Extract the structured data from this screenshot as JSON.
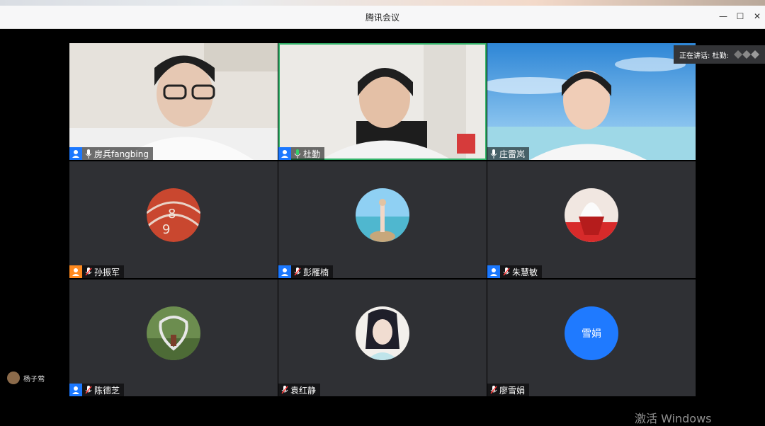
{
  "window": {
    "title": "腾讯会议"
  },
  "controls": {
    "minimize": "—",
    "maximize": "☐",
    "close": "✕"
  },
  "speaking": {
    "text": "正在讲话: 杜勤:"
  },
  "participants": [
    {
      "name": "房兵fangbing"
    },
    {
      "name": "杜勤"
    },
    {
      "name": "庄雷岚"
    },
    {
      "name": "孙振军"
    },
    {
      "name": "彭雁楠"
    },
    {
      "name": "朱慧敏"
    },
    {
      "name": "陈德芝"
    },
    {
      "name": "袁红静"
    },
    {
      "name": "廖雪娟",
      "avatar_text": "雪娟"
    }
  ],
  "sidebar_user": {
    "name": "杨子莺"
  },
  "watermark": {
    "text": "激活 Windows"
  },
  "colors": {
    "accent": "#1b78ff",
    "active_border": "#33b36a",
    "tile_bg": "#2f3034",
    "avatar_blue": "#1f7aff"
  }
}
